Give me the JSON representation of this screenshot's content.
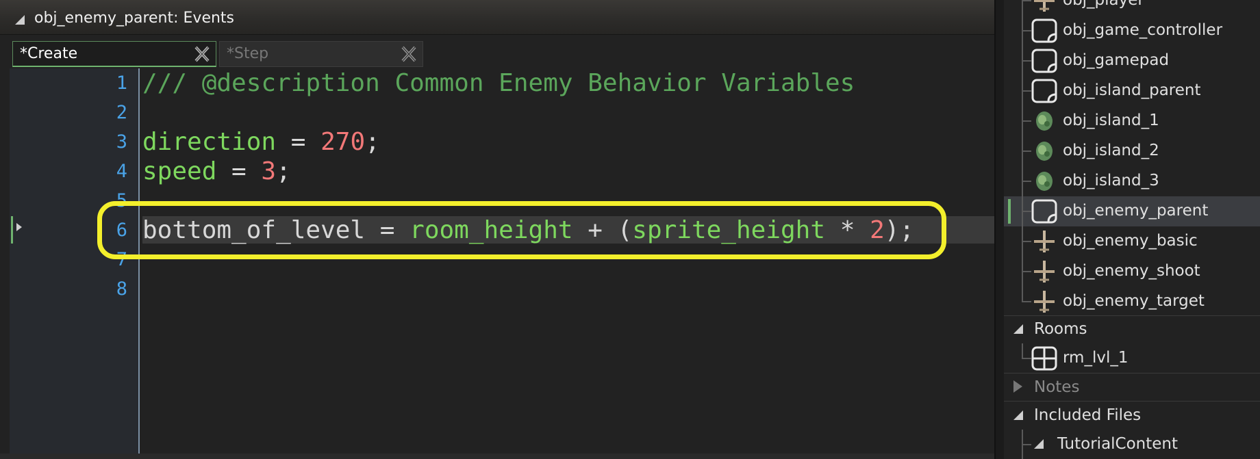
{
  "window": {
    "title": "obj_enemy_parent: Events"
  },
  "tabs": [
    {
      "label": "*Create",
      "active": true
    },
    {
      "label": "*Step",
      "active": false
    }
  ],
  "editor": {
    "line_numbers": [
      "1",
      "2",
      "3",
      "4",
      "5",
      "6",
      "7",
      "8"
    ],
    "current_line": 6,
    "lines": [
      [
        {
          "t": "/// @description Common Enemy Behavior Variables",
          "c": "cmt"
        }
      ],
      [],
      [
        {
          "t": "direction",
          "c": "var"
        },
        {
          "t": " = ",
          "c": "op"
        },
        {
          "t": "270",
          "c": "num"
        },
        {
          "t": ";",
          "c": "op"
        }
      ],
      [
        {
          "t": "speed",
          "c": "var"
        },
        {
          "t": " = ",
          "c": "op"
        },
        {
          "t": "3",
          "c": "num"
        },
        {
          "t": ";",
          "c": "op"
        }
      ],
      [],
      [
        {
          "t": "bottom_of_level",
          "c": "op"
        },
        {
          "t": " = ",
          "c": "op"
        },
        {
          "t": "room_height",
          "c": "var"
        },
        {
          "t": " + (",
          "c": "op"
        },
        {
          "t": "sprite_height",
          "c": "var"
        },
        {
          "t": " * ",
          "c": "op"
        },
        {
          "t": "2",
          "c": "num"
        },
        {
          "t": ");",
          "c": "op"
        }
      ],
      [],
      []
    ]
  },
  "resource_tree": {
    "objects": [
      {
        "label": "obj_player",
        "icon": "plane-sprite-icon"
      },
      {
        "label": "obj_game_controller",
        "icon": "object-icon"
      },
      {
        "label": "obj_gamepad",
        "icon": "object-icon"
      },
      {
        "label": "obj_island_parent",
        "icon": "object-icon"
      },
      {
        "label": "obj_island_1",
        "icon": "island-sprite-icon"
      },
      {
        "label": "obj_island_2",
        "icon": "island-sprite-icon"
      },
      {
        "label": "obj_island_3",
        "icon": "island-sprite-icon"
      },
      {
        "label": "obj_enemy_parent",
        "icon": "object-icon",
        "selected": true
      },
      {
        "label": "obj_enemy_basic",
        "icon": "plane-sprite-icon"
      },
      {
        "label": "obj_enemy_shoot",
        "icon": "plane-sprite-icon"
      },
      {
        "label": "obj_enemy_target",
        "icon": "plane-sprite-icon"
      }
    ],
    "rooms_group": "Rooms",
    "rooms": [
      {
        "label": "rm_lvl_1",
        "icon": "room-icon"
      }
    ],
    "notes_group": "Notes",
    "included_files_group": "Included Files",
    "included_files_child": "TutorialContent"
  },
  "colors": {
    "comment": "#5ba65b",
    "builtin": "#7ed85e",
    "number": "#f27878",
    "line_number": "#4aa3e8",
    "highlight": "#f3ef2c",
    "selection_accent": "#6fb36f"
  }
}
